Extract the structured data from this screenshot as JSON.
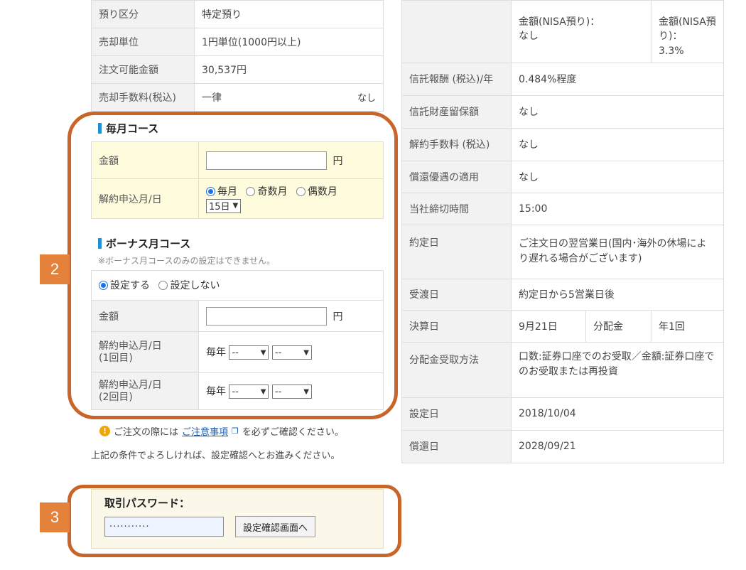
{
  "top_table": [
    {
      "label": "預り区分",
      "value": "特定預り"
    },
    {
      "label": "売却単位",
      "value": "1円単位(1000円以上)"
    },
    {
      "label": "注文可能金額",
      "value": "30,537円"
    },
    {
      "label": "売却手数料(税込)",
      "value": "一律",
      "extra": "なし"
    }
  ],
  "monthly": {
    "title": "毎月コース",
    "amount_label": "金額",
    "amount_value": "",
    "unit": "円",
    "date_label": "解約申込月/日",
    "options": [
      "毎月",
      "奇数月",
      "偶数月"
    ],
    "selected_option": "毎月",
    "day_value": "15日"
  },
  "bonus": {
    "title": "ボーナス月コース",
    "note": "※ボーナス月コースのみの設定はできません。",
    "options": [
      "設定する",
      "設定しない"
    ],
    "selected_option": "設定する",
    "amount_label": "金額",
    "amount_value": "",
    "unit": "円",
    "first_label": "解約申込月/日\n(1回目)",
    "second_label": "解約申込月/日\n(2回目)",
    "every_year": "毎年",
    "month_placeholder": "--",
    "day_placeholder": "--"
  },
  "notice": {
    "prefix": "ご注文の際には",
    "link": "ご注意事項",
    "suffix": "を必ずご確認ください。"
  },
  "proceed_note": "上記の条件でよろしければ、設定確認へとお進みください。",
  "password": {
    "label": "取引パスワード：",
    "value": "···········",
    "button": "設定確認画面へ"
  },
  "steps": {
    "two": "2",
    "three": "3"
  },
  "right_table": {
    "nisa_a": "金額(NISA預り)：\nなし",
    "nisa_b": "金額(NISA預り)：\n3.3%",
    "rows": [
      {
        "label": "信託報酬 (税込)/年",
        "value": "0.484%程度"
      },
      {
        "label": "信託財産留保額",
        "value": "なし"
      },
      {
        "label": "解約手数料 (税込)",
        "value": "なし"
      },
      {
        "label": "償還優遇の適用",
        "value": "なし"
      },
      {
        "label": "当社締切時間",
        "value": "15:00"
      },
      {
        "label": "約定日",
        "value": "ご注文日の翌営業日(国内･海外の休場により遅れる場合がございます)"
      },
      {
        "label": "受渡日",
        "value": "約定日から5営業日後"
      }
    ],
    "settlement": {
      "label": "決算日",
      "date": "9月21日",
      "dist_label": "分配金",
      "dist_value": "年1回"
    },
    "rows2": [
      {
        "label": "分配金受取方法",
        "value": "口数:証券口座でのお受取／金額:証券口座でのお受取または再投資"
      },
      {
        "label": "設定日",
        "value": "2018/10/04"
      },
      {
        "label": "償還日",
        "value": "2028/09/21"
      }
    ]
  },
  "colors": {
    "frame": "#c8652a",
    "badge": "#e4823c",
    "accent_bar": "#1f8fd6",
    "monthly_bg": "#fffbdd"
  }
}
